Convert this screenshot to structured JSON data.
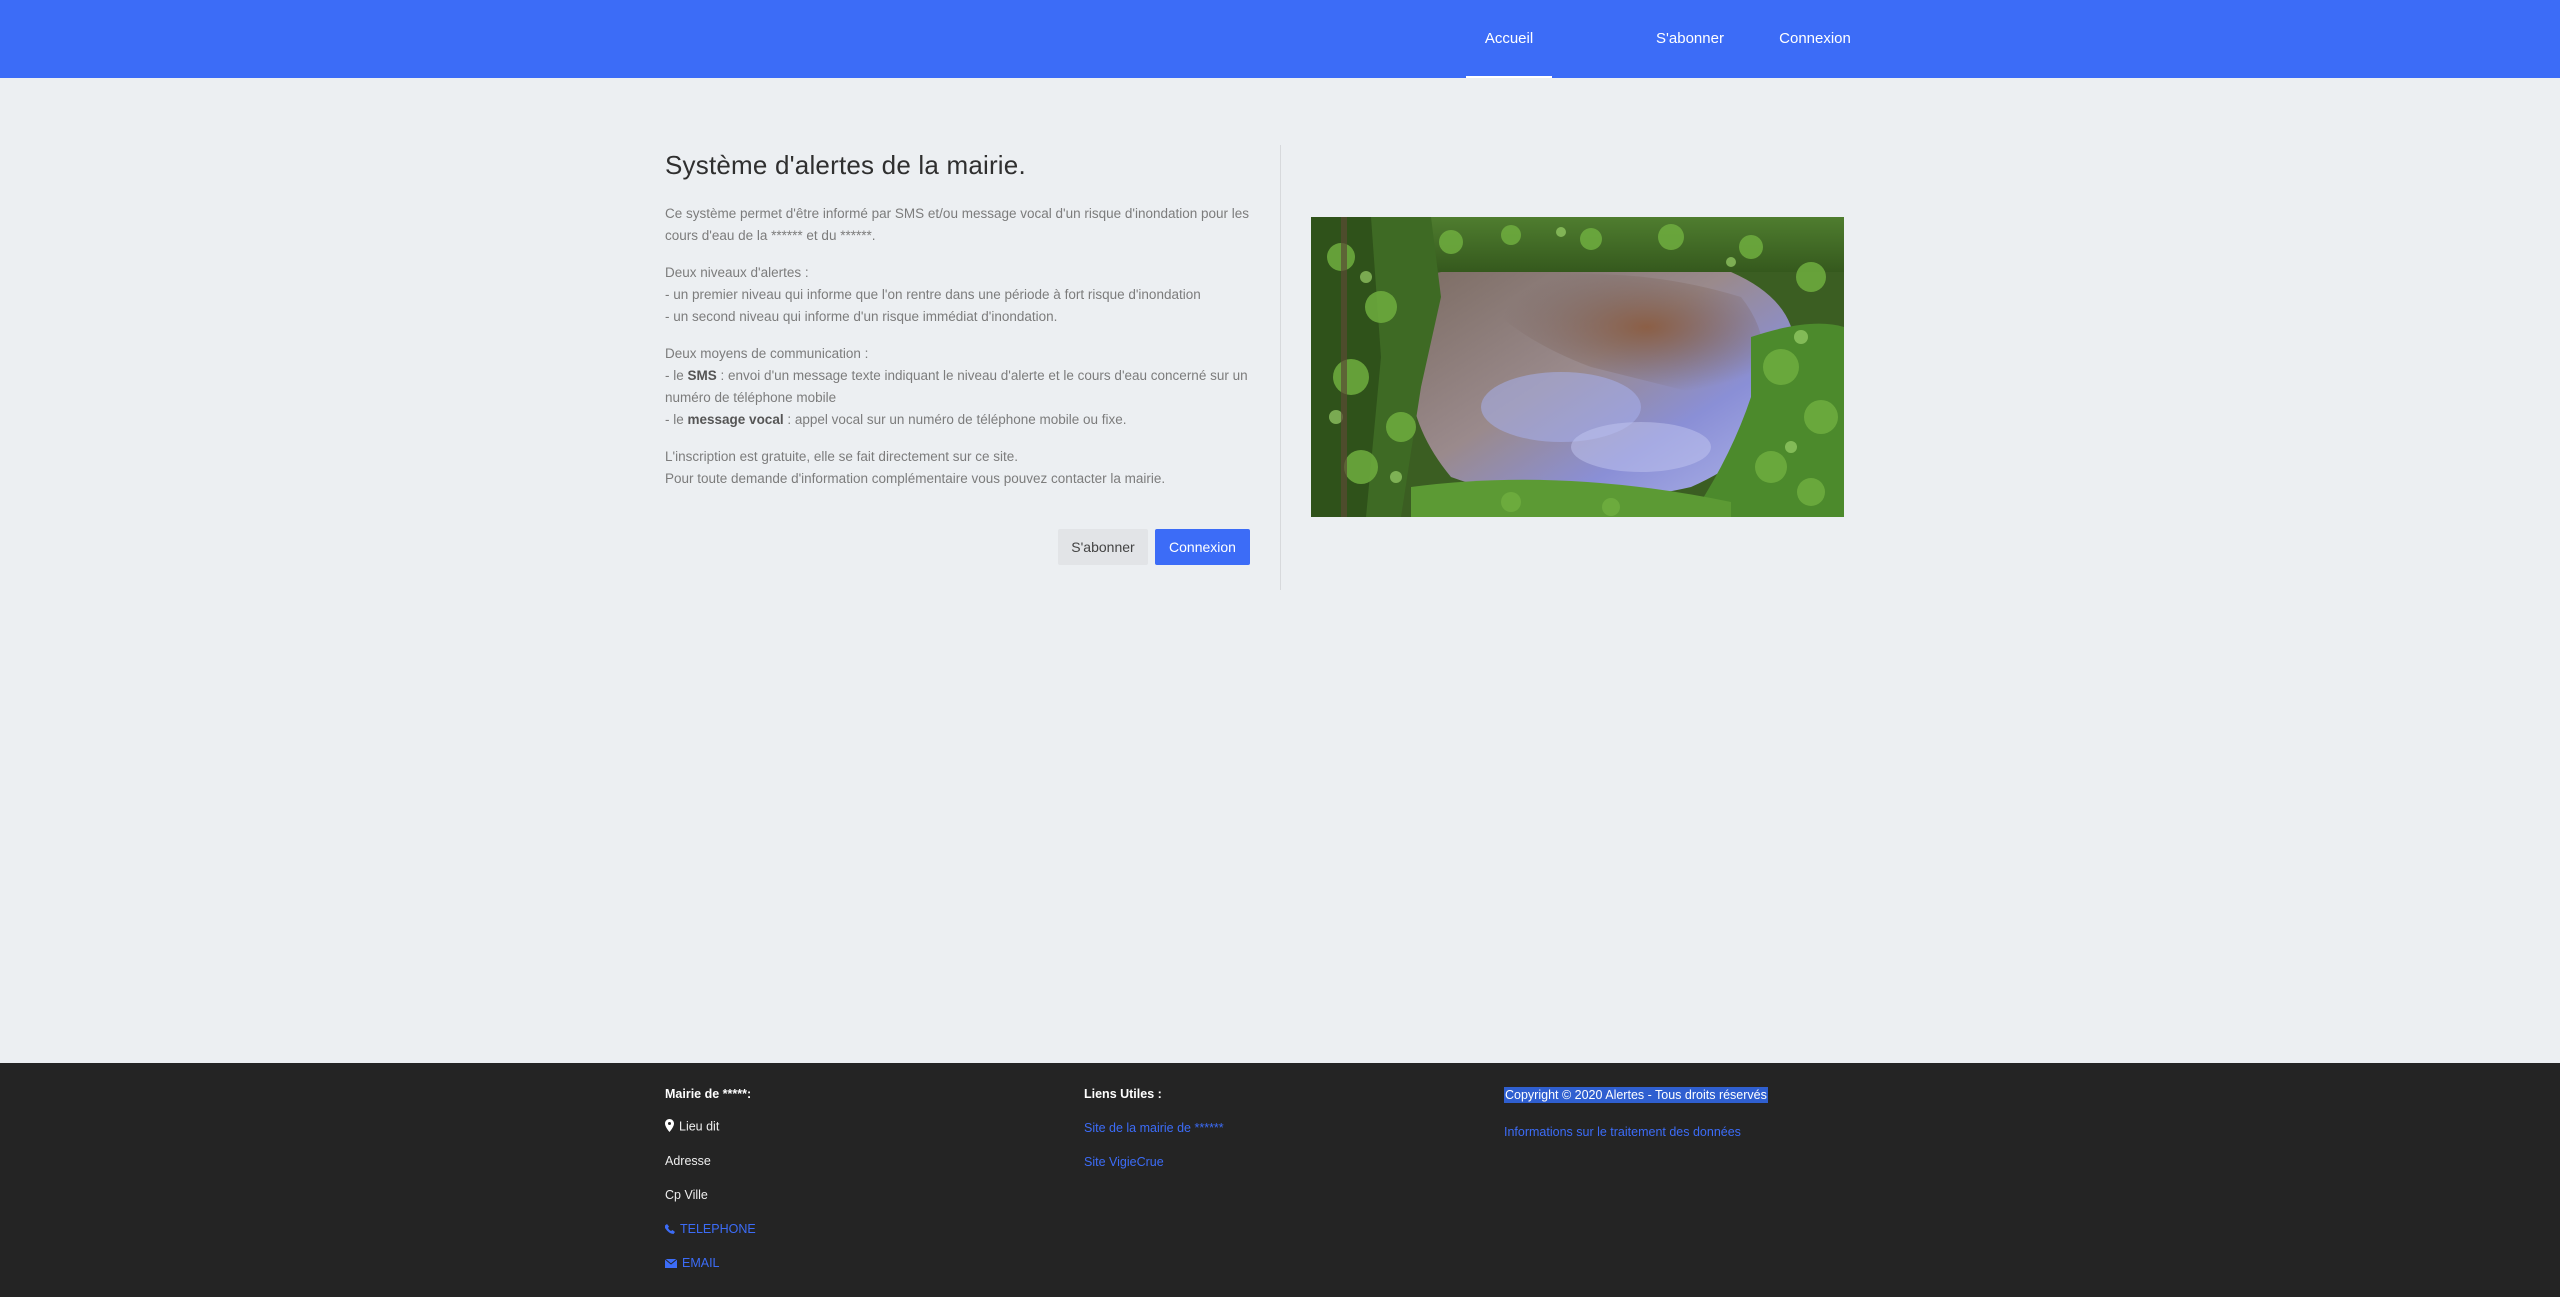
{
  "nav": {
    "home": "Accueil",
    "subscribe": "S'abonner",
    "login": "Connexion"
  },
  "main": {
    "title": "Système d'alertes de la mairie.",
    "intro": "Ce système permet d'être informé par SMS et/ou message vocal d'un risque d'inondation pour les cours d'eau de la ****** et du ******.",
    "levels_title": "Deux niveaux d'alertes :",
    "level_1": "- un premier niveau qui informe que l'on rentre dans une période à fort risque d'inondation",
    "level_2": "- un second niveau qui informe d'un risque immédiat d'inondation.",
    "means_title": "Deux moyens de communication :",
    "sms_prefix": "- le ",
    "sms_bold": "SMS",
    "sms_text": " : envoi d'un message texte indiquant le niveau d'alerte et le cours d'eau concerné sur un numéro de téléphone mobile",
    "voice_prefix": "- le ",
    "voice_bold": "message vocal",
    "voice_text": " : appel vocal sur un numéro de téléphone mobile ou fixe.",
    "free_text": "L'inscription est gratuite, elle se fait directement sur ce site.",
    "contact_text": "Pour toute demande d'information complémentaire vous pouvez contacter la mairie.",
    "btn_subscribe": "S'abonner",
    "btn_login": "Connexion"
  },
  "footer": {
    "col1": {
      "title": "Mairie de *****:",
      "place": "Lieu dit",
      "address": "Adresse",
      "city": "Cp Ville",
      "phone": "TELEPHONE",
      "email": "EMAIL"
    },
    "col2": {
      "title": "Liens Utiles :",
      "link_1": "Site de la mairie de ******",
      "link_2": "Site VigieCrue"
    },
    "col3": {
      "copyright": "Copyright © 2020 Alertes - Tous droits réservés",
      "privacy": "Informations sur le traitement des données"
    }
  },
  "colors": {
    "primary": "#3c6cf7",
    "background": "#eceff2",
    "footer_bg": "#242424"
  },
  "icons": {
    "location": "map-marker-icon",
    "phone": "phone-icon",
    "email": "envelope-icon"
  }
}
